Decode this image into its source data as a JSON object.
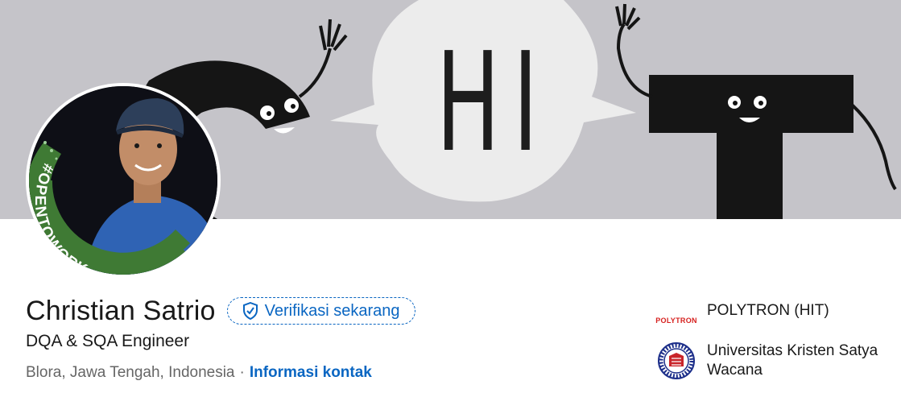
{
  "banner": {
    "text": "HI"
  },
  "profile": {
    "name": "Christian Satrio",
    "verify_label": "Verifikasi sekarang",
    "headline": "DQA & SQA Engineer",
    "location": "Blora, Jawa Tengah, Indonesia",
    "separator": "·",
    "contact_link": "Informasi kontak",
    "open_to_work_badge": "#OPENTOWORK"
  },
  "organizations": [
    {
      "logo_text": "POLYTRON",
      "name": "POLYTRON (HIT)"
    },
    {
      "logo_text": "",
      "name": "Universitas Kristen Satya Wacana"
    }
  ],
  "colors": {
    "accent": "#0a66c2",
    "open_to_work_green": "#3f7a34",
    "banner_bg": "#c5c4c9",
    "polytron_red": "#d6201e"
  }
}
